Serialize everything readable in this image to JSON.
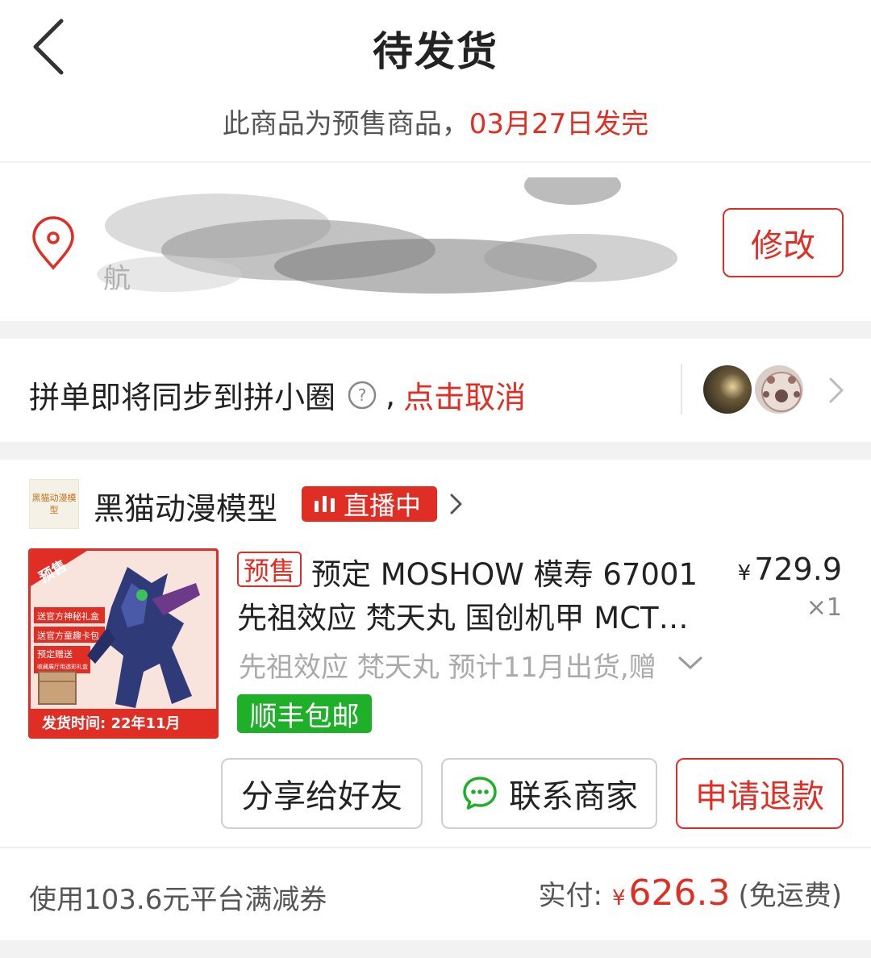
{
  "header": {
    "title": "待发货",
    "presale_prefix": "此商品为预售商品，",
    "presale_date": "03月27日发完"
  },
  "address": {
    "partial_text": "航",
    "edit_label": "修改"
  },
  "group": {
    "text": "拼单即将同步到拼小圈",
    "separator": ",",
    "cancel_label": "点击取消"
  },
  "shop": {
    "logo_text": "黑猫动漫模型",
    "name": "黑猫动漫模型",
    "live_badge": "直播中"
  },
  "product": {
    "tag": "预售",
    "title_line1": "预定 MOSHOW 模寿 67001",
    "title_line2": "先祖效应 梵天丸 国创机甲 MCT…",
    "currency": "¥",
    "price": "729.9",
    "quantity": "×1",
    "spec": "先祖效应 梵天丸 预计11月出货,赠",
    "shipping_tag": "顺丰包邮",
    "image": {
      "badge": "预售",
      "gift1": "送官方神秘礼盒",
      "gift2": "送官方童趣卡包",
      "gift3_title": "预定赠送",
      "gift3_sub": "收藏展厅用透彩礼盒",
      "ship_time": "发货时间: 22年11月"
    }
  },
  "actions": {
    "share_label": "分享给好友",
    "contact_label": "联系商家",
    "refund_label": "申请退款"
  },
  "footer": {
    "coupon_text": "使用103.6元平台满减券",
    "paid_label": "实付:",
    "currency": "¥",
    "paid_amount": "626.3",
    "shipping_note": "(免运费)"
  }
}
